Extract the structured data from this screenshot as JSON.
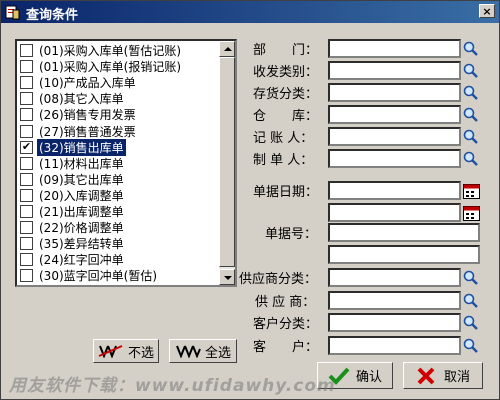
{
  "window": {
    "title": "查询条件",
    "close_glyph": "×"
  },
  "list": {
    "items": [
      {
        "label": "(01)采购入库单(暂估记账)",
        "checked": false
      },
      {
        "label": "(01)采购入库单(报销记账)",
        "checked": false
      },
      {
        "label": "(10)产成品入库单",
        "checked": false
      },
      {
        "label": "(08)其它入库单",
        "checked": false
      },
      {
        "label": "(26)销售专用发票",
        "checked": false
      },
      {
        "label": "(27)销售普通发票",
        "checked": false
      },
      {
        "label": "(32)销售出库单",
        "checked": true,
        "selected": true
      },
      {
        "label": "(11)材料出库单",
        "checked": false
      },
      {
        "label": "(09)其它出库单",
        "checked": false
      },
      {
        "label": "(20)入库调整单",
        "checked": false
      },
      {
        "label": "(21)出库调整单",
        "checked": false
      },
      {
        "label": "(22)价格调整单",
        "checked": false
      },
      {
        "label": "(35)差异结转单",
        "checked": false
      },
      {
        "label": "(24)红字回冲单",
        "checked": false
      },
      {
        "label": "(30)蓝字回冲单(暂估)",
        "checked": false
      }
    ]
  },
  "buttons": {
    "deselect": "不选",
    "select_all": "全选",
    "ok": "确认",
    "cancel": "取消"
  },
  "fields": {
    "department": "部　　门：",
    "dispatch_category": "收发类别：",
    "inventory_category": "存货分类：",
    "warehouse": "仓　　库：",
    "bookkeeper": "记 账 人：",
    "maker": "制 单 人：",
    "doc_date": "单据日期：",
    "doc_number": "单据号：",
    "supplier_category": "供应商分类：",
    "supplier": "供 应 商：",
    "customer_category": "客户分类：",
    "customer": "客　　户："
  },
  "watermark": "用友软件下载：www.ufidawhy.com",
  "colors": {
    "title_bar": "#0a246a",
    "selection": "#0a246a",
    "face": "#d4d0c8"
  }
}
